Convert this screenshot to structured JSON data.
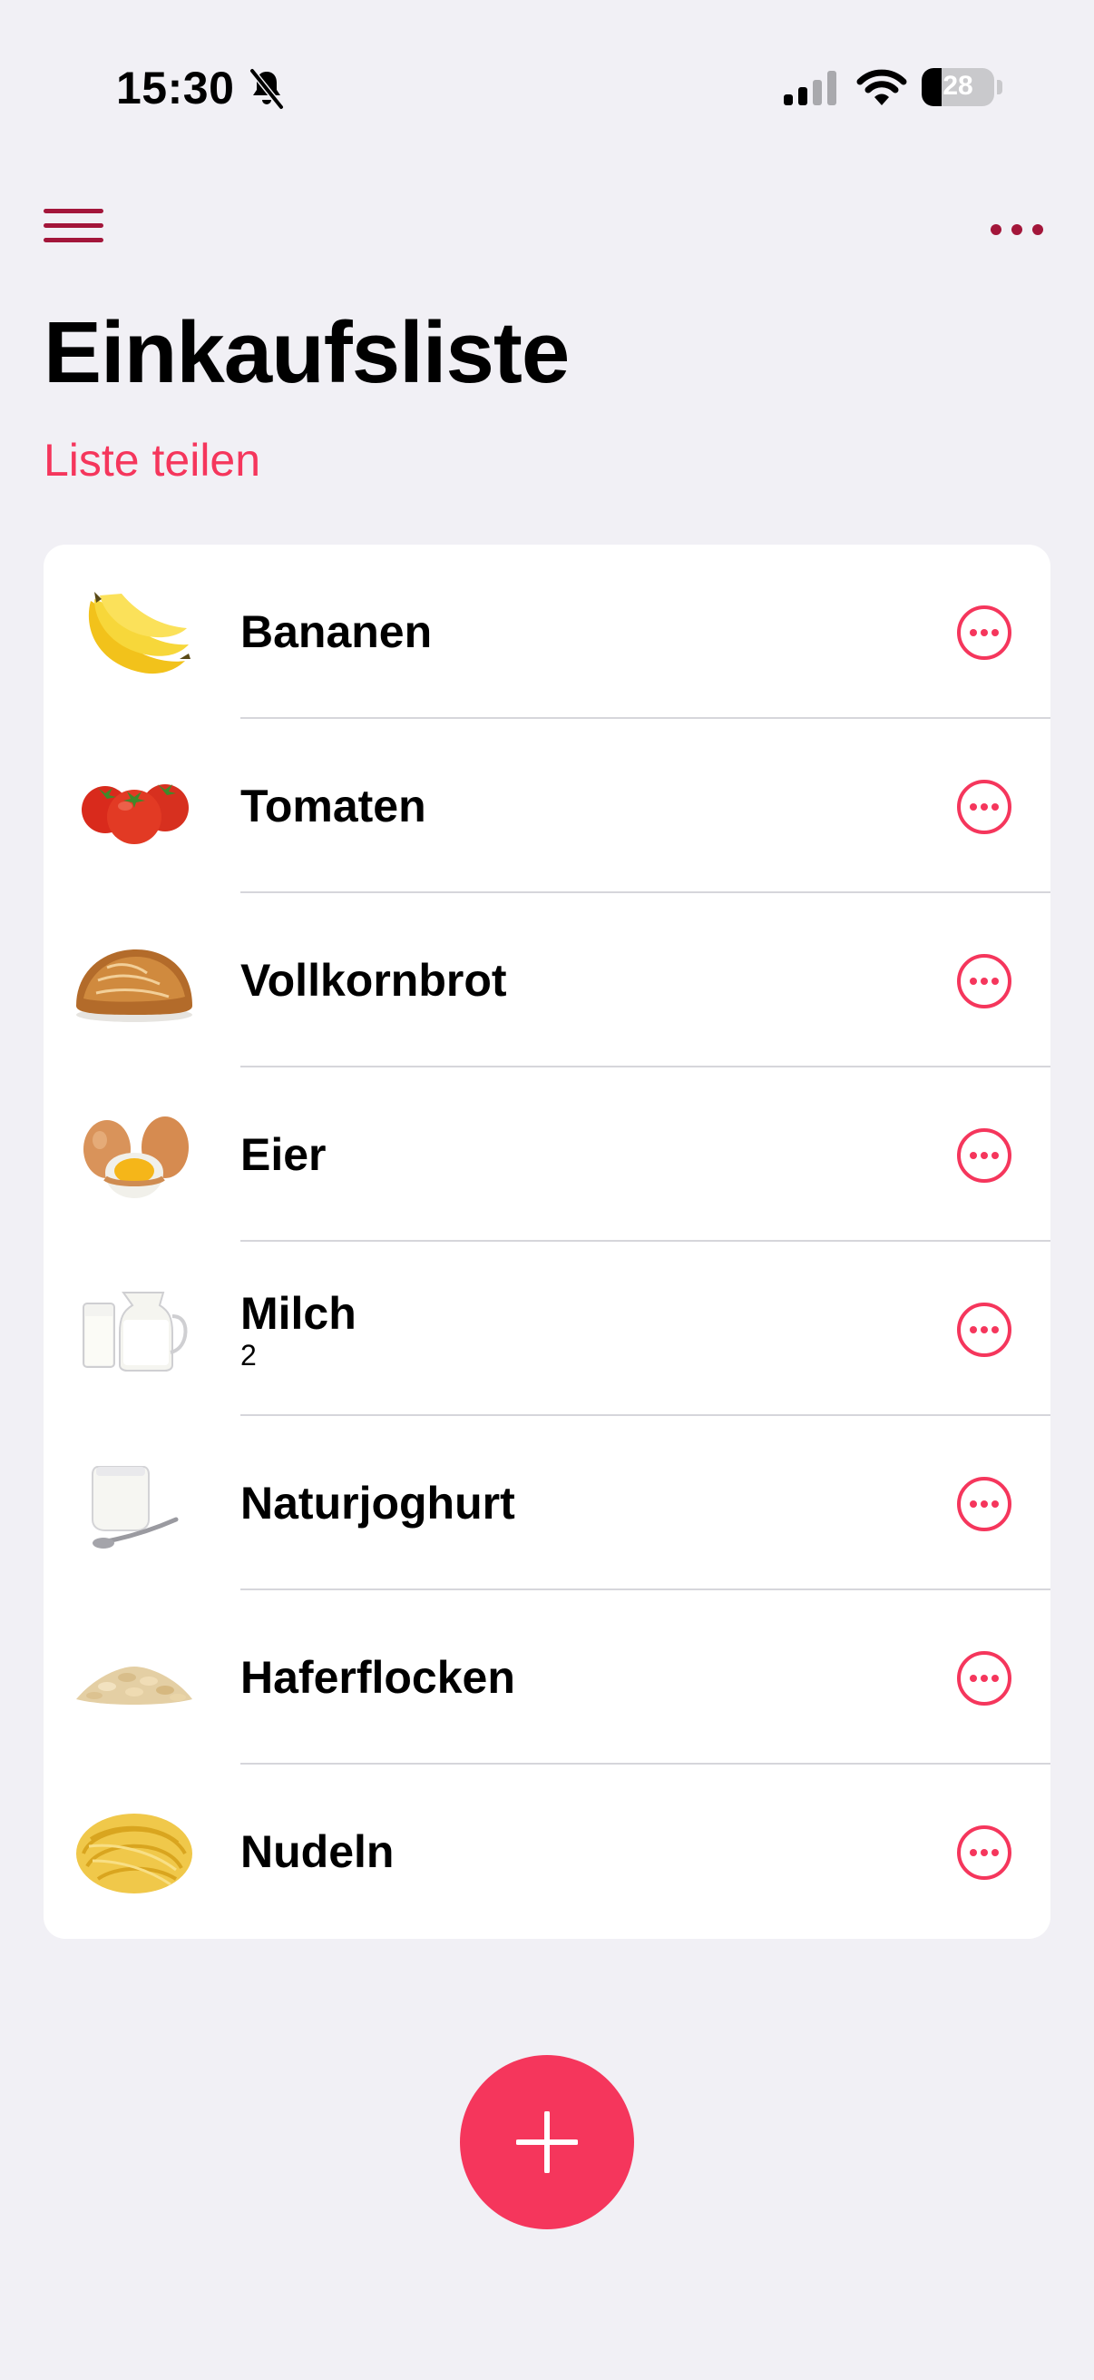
{
  "status_bar": {
    "time": "15:30",
    "battery_level": "28",
    "battery_fraction": 0.28,
    "icons": [
      "bell-muted-icon",
      "cellular-signal-icon",
      "wifi-icon",
      "battery-icon"
    ]
  },
  "nav": {
    "menu_icon": "hamburger-menu-icon",
    "more_icon": "ellipsis-icon"
  },
  "page": {
    "title": "Einkaufsliste",
    "share_label": "Liste teilen"
  },
  "items": [
    {
      "name": "Bananen",
      "quantity": "",
      "image": "banana-image"
    },
    {
      "name": "Tomaten",
      "quantity": "",
      "image": "tomato-image"
    },
    {
      "name": "Vollkornbrot",
      "quantity": "",
      "image": "bread-image"
    },
    {
      "name": "Eier",
      "quantity": "",
      "image": "eggs-image"
    },
    {
      "name": "Milch",
      "quantity": "2",
      "image": "milk-image"
    },
    {
      "name": "Naturjoghurt",
      "quantity": "",
      "image": "yogurt-image"
    },
    {
      "name": "Haferflocken",
      "quantity": "",
      "image": "oats-image"
    },
    {
      "name": "Nudeln",
      "quantity": "",
      "image": "pasta-image"
    }
  ],
  "colors": {
    "accent": "#f5365c",
    "nav_accent": "#a3163a",
    "background": "#f1f0f5",
    "card": "#ffffff"
  },
  "fab": {
    "icon": "plus-icon"
  }
}
